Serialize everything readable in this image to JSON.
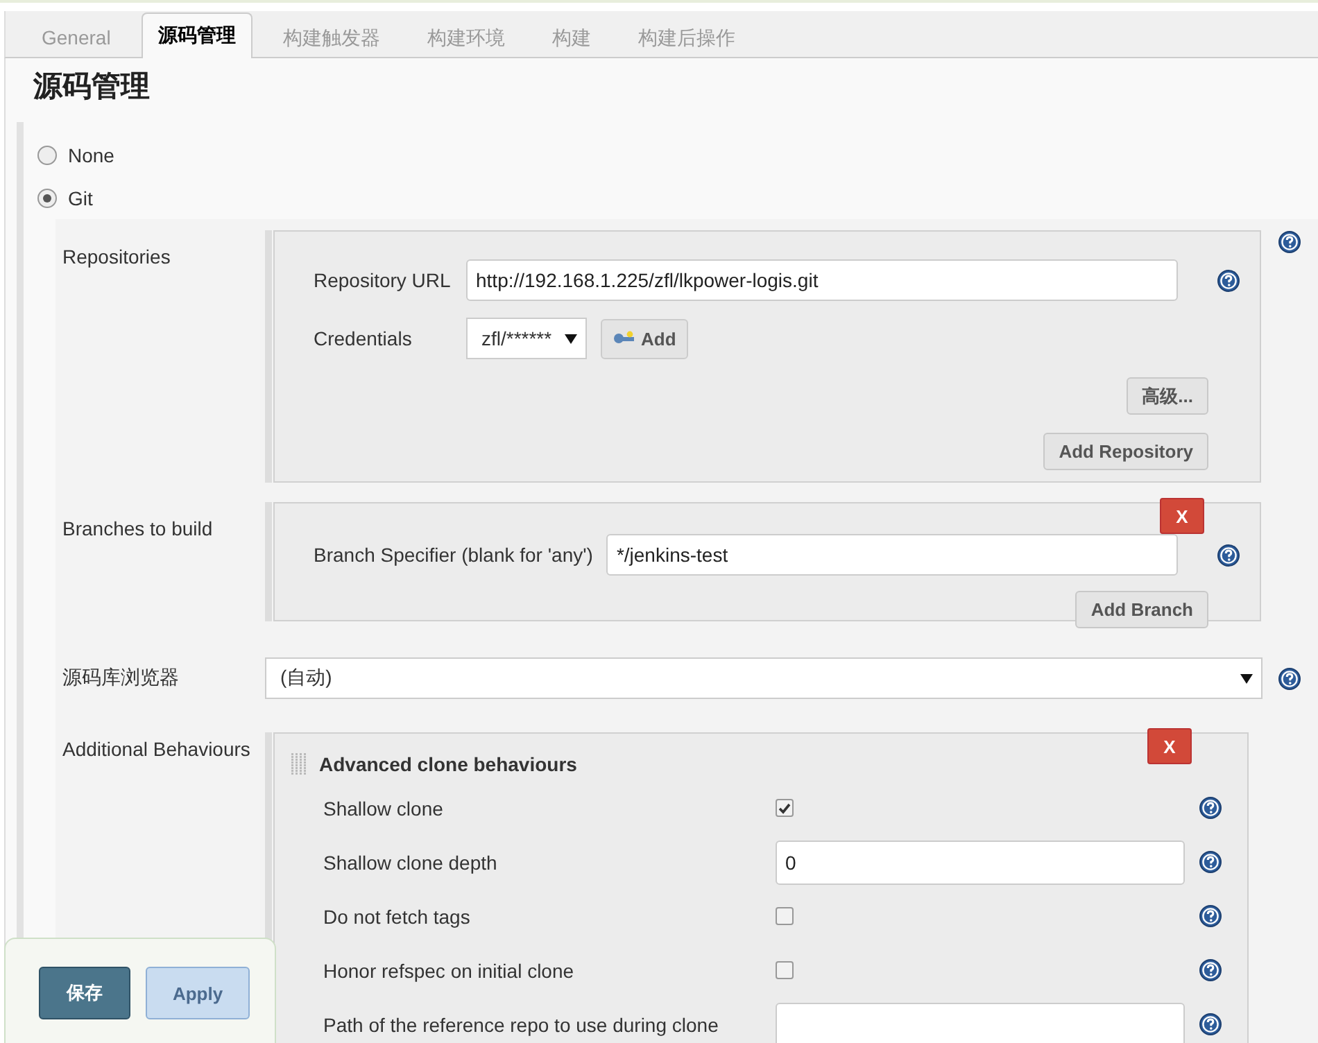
{
  "tabs": [
    {
      "label": "General",
      "selected": false
    },
    {
      "label": "源码管理",
      "selected": true
    },
    {
      "label": "构建触发器",
      "selected": false
    },
    {
      "label": "构建环境",
      "selected": false
    },
    {
      "label": "构建",
      "selected": false
    },
    {
      "label": "构建后操作",
      "selected": false
    }
  ],
  "heading": "源码管理",
  "scm_options": [
    {
      "label": "None",
      "selected": false
    },
    {
      "label": "Git",
      "selected": true
    }
  ],
  "repositories": {
    "label": "Repositories",
    "url_label": "Repository URL",
    "url": "http://192.168.1.225/zfl/lkpower-logis.git",
    "credentials_label": "Credentials",
    "credentials": "zfl/******",
    "add_button": "Add",
    "advanced_button": "高级...",
    "add_repository_button": "Add Repository"
  },
  "branches": {
    "label": "Branches to build",
    "delete_button": "X",
    "specifier_label": "Branch Specifier (blank for 'any')",
    "specifier": "*/jenkins-test",
    "add_branch_button": "Add Branch"
  },
  "browser": {
    "label": "源码库浏览器",
    "value": "(自动)"
  },
  "behaviours": {
    "label": "Additional Behaviours",
    "title": "Advanced clone behaviours",
    "delete_button": "X",
    "rows": [
      {
        "kind": "checkbox",
        "label": "Shallow clone",
        "checked": true
      },
      {
        "kind": "text",
        "label": "Shallow clone depth",
        "value": "0"
      },
      {
        "kind": "checkbox",
        "label": "Do not fetch tags",
        "checked": false
      },
      {
        "kind": "checkbox",
        "label": "Honor refspec on initial clone",
        "checked": false
      },
      {
        "kind": "text",
        "label": "Path of the reference repo to use during clone"
      }
    ]
  },
  "actions": {
    "save": "保存",
    "apply": "Apply"
  }
}
